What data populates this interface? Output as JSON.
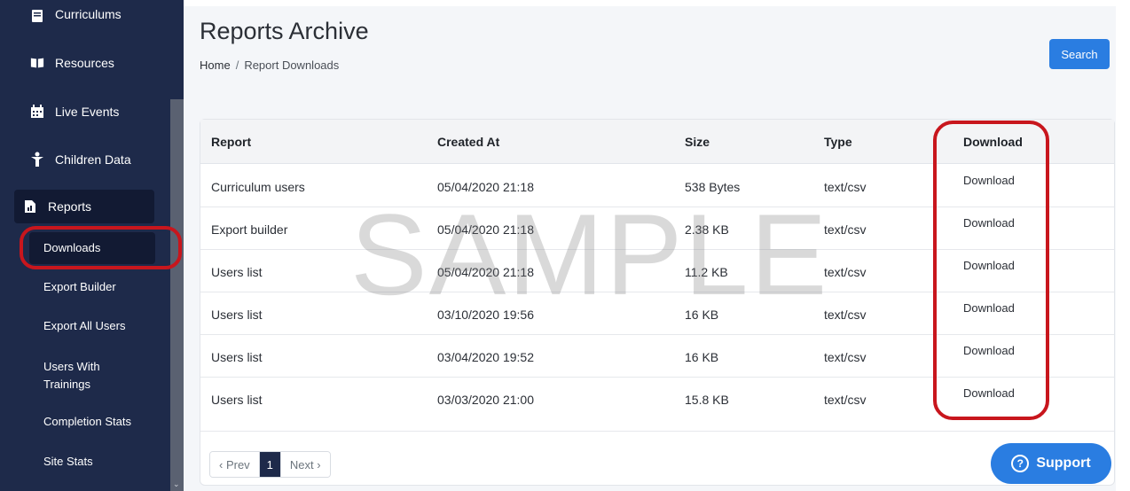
{
  "sidebar": {
    "items": [
      {
        "label": "Curriculums",
        "icon": "book-icon"
      },
      {
        "label": "Resources",
        "icon": "open-book-icon"
      },
      {
        "label": "Live Events",
        "icon": "calendar-icon"
      },
      {
        "label": "Children Data",
        "icon": "child-icon"
      },
      {
        "label": "Reports",
        "icon": "report-icon"
      }
    ],
    "sub_items": [
      {
        "label": "Downloads"
      },
      {
        "label": "Export Builder"
      },
      {
        "label": "Export All Users"
      },
      {
        "label": "Users With Trainings"
      },
      {
        "label": "Completion Stats"
      },
      {
        "label": "Site Stats"
      }
    ]
  },
  "header": {
    "title": "Reports Archive",
    "breadcrumb": {
      "home": "Home",
      "separator": "/",
      "current": "Report Downloads"
    },
    "search_label": "Search"
  },
  "table": {
    "columns": [
      "Report",
      "Created At",
      "Size",
      "Type",
      "Download"
    ],
    "rows": [
      {
        "report": "Curriculum users",
        "created": "05/04/2020 21:18",
        "size": "538 Bytes",
        "type": "text/csv",
        "download": "Download"
      },
      {
        "report": "Export builder",
        "created": "05/04/2020 21:18",
        "size": "2.38 KB",
        "type": "text/csv",
        "download": "Download"
      },
      {
        "report": "Users list",
        "created": "05/04/2020 21:18",
        "size": "11.2 KB",
        "type": "text/csv",
        "download": "Download"
      },
      {
        "report": "Users list",
        "created": "03/10/2020 19:56",
        "size": "16 KB",
        "type": "text/csv",
        "download": "Download"
      },
      {
        "report": "Users list",
        "created": "03/04/2020 19:52",
        "size": "16 KB",
        "type": "text/csv",
        "download": "Download"
      },
      {
        "report": "Users list",
        "created": "03/03/2020 21:00",
        "size": "15.8 KB",
        "type": "text/csv",
        "download": "Download"
      }
    ]
  },
  "pagination": {
    "prev": "‹ Prev",
    "current": "1",
    "next": "Next ›"
  },
  "watermark": "SAMPLE",
  "support": {
    "label": "Support",
    "icon": "question-circle-icon"
  },
  "colors": {
    "sidebar": "#1e2a4a",
    "accent": "#2a7de1",
    "highlight_ring": "#c8161d"
  }
}
